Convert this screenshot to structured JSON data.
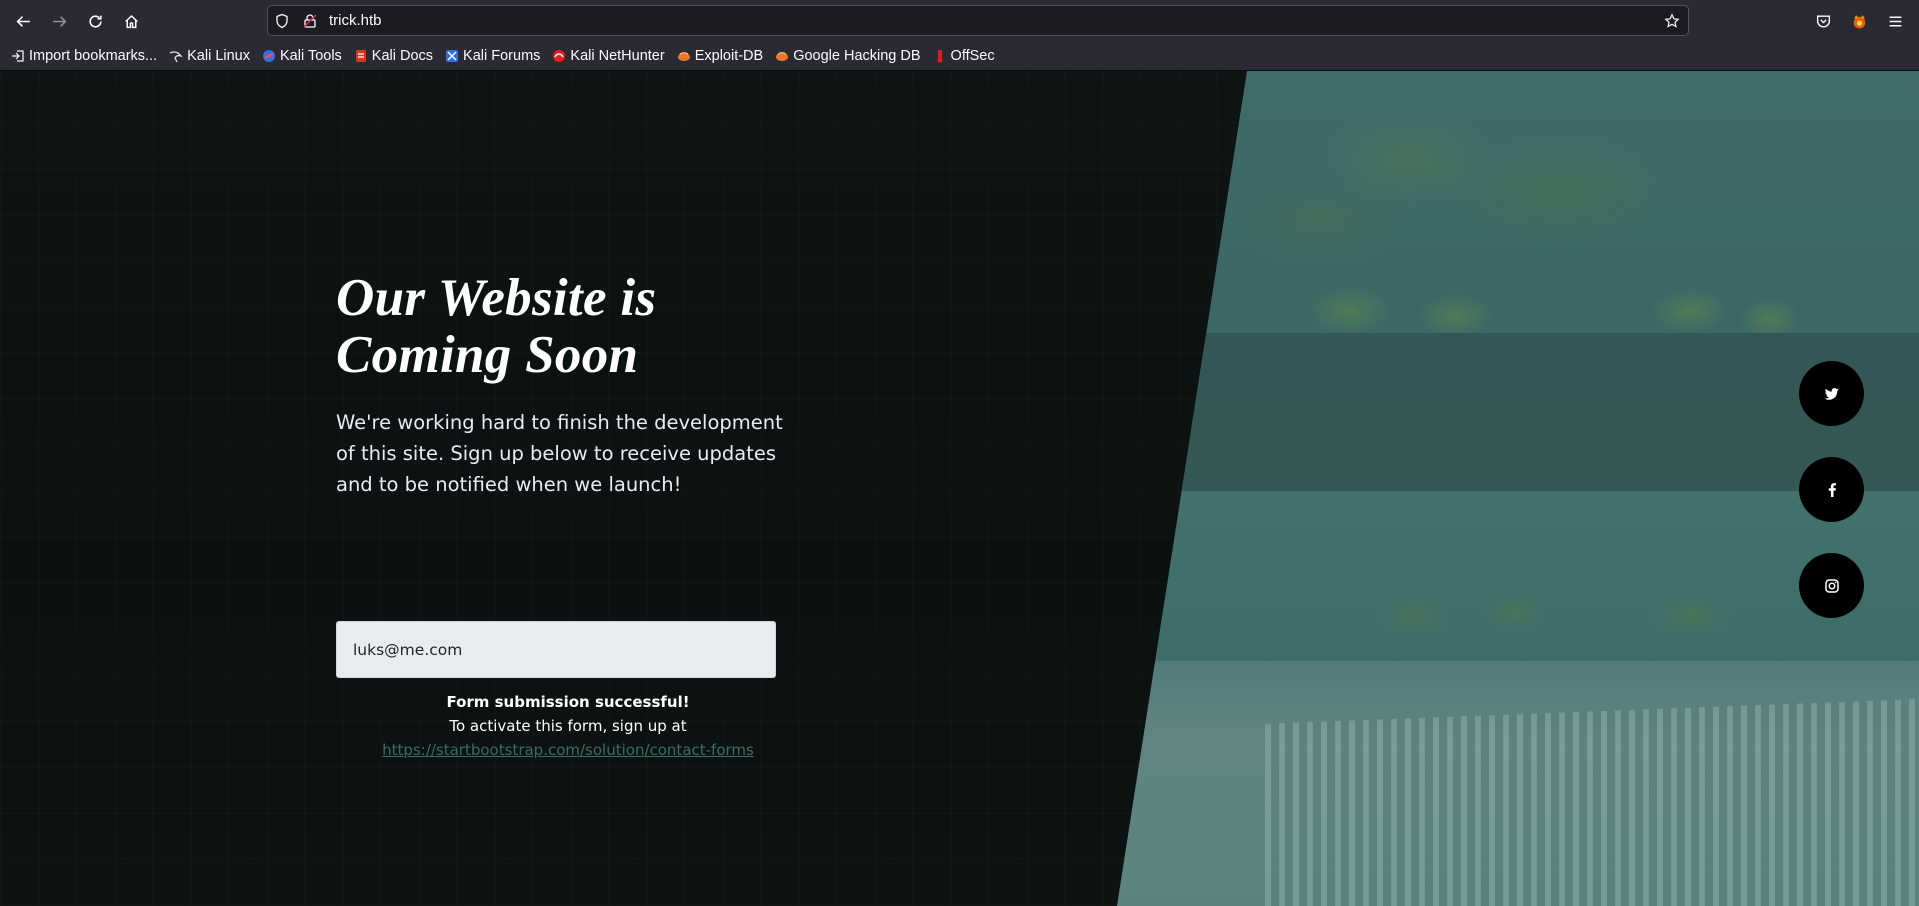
{
  "browser": {
    "url": "trick.htb",
    "bookmarks": [
      {
        "label": "Import bookmarks...",
        "icon": "import-icon"
      },
      {
        "label": "Kali Linux",
        "icon": "kali-dragon-icon"
      },
      {
        "label": "Kali Tools",
        "icon": "kali-tools-icon"
      },
      {
        "label": "Kali Docs",
        "icon": "kali-docs-icon"
      },
      {
        "label": "Kali Forums",
        "icon": "kali-forums-icon"
      },
      {
        "label": "Kali NetHunter",
        "icon": "kali-nethunter-icon"
      },
      {
        "label": "Exploit-DB",
        "icon": "exploit-db-icon"
      },
      {
        "label": "Google Hacking DB",
        "icon": "ghdb-icon"
      },
      {
        "label": "OffSec",
        "icon": "offsec-icon"
      }
    ]
  },
  "page": {
    "headline_line1": "Our Website is",
    "headline_line2": "Coming Soon",
    "subtext": "We're working hard to finish the development of this site. Sign up below to receive updates and to be notified when we launch!",
    "email_value": "luks@me.com",
    "success_title": "Form submission successful!",
    "success_text": "To activate this form, sign up at",
    "success_link": "https://startbootstrap.com/solution/contact-forms"
  },
  "social": [
    {
      "icon": "twitter-icon"
    },
    {
      "icon": "facebook-icon"
    },
    {
      "icon": "instagram-icon"
    }
  ],
  "colors": {
    "chrome_bg": "#2b2a33",
    "url_bg": "#1c1b22",
    "page_bg": "#0d1212",
    "accent_link": "#3c6b67",
    "input_bg": "#e9ecef"
  }
}
